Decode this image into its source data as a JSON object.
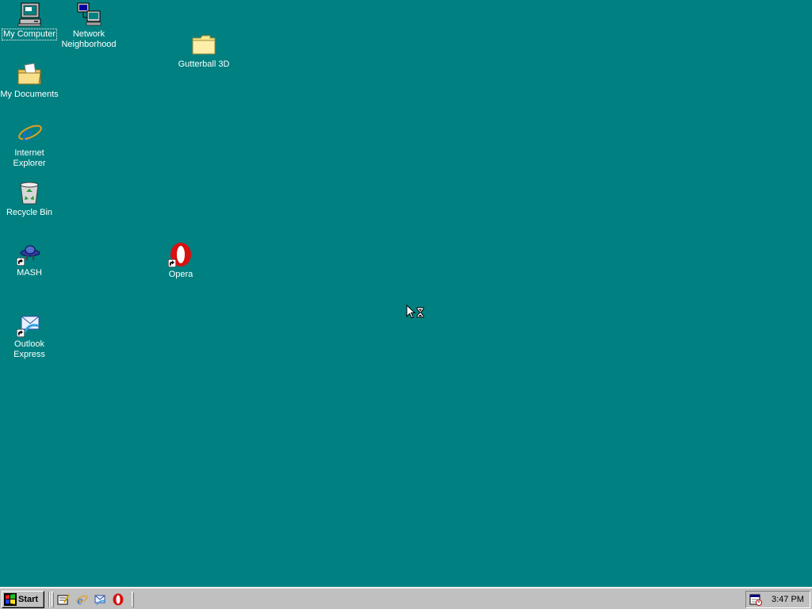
{
  "desktop": {
    "background_color": "#008080",
    "icons": [
      {
        "id": "my-computer",
        "label": "My Computer",
        "icon": "computer-icon",
        "selected": true
      },
      {
        "id": "network-neighborhood",
        "label": "Network\nNeighborhood",
        "icon": "network-icon"
      },
      {
        "id": "gutterball-3d",
        "label": "Gutterball 3D",
        "icon": "folder-icon"
      },
      {
        "id": "my-documents",
        "label": "My Documents",
        "icon": "documents-folder-icon"
      },
      {
        "id": "internet-explorer",
        "label": "Internet\nExplorer",
        "icon": "internet-explorer-icon"
      },
      {
        "id": "recycle-bin",
        "label": "Recycle Bin",
        "icon": "recycle-bin-icon"
      },
      {
        "id": "mash",
        "label": "MASH",
        "icon": "mash-icon",
        "shortcut": true
      },
      {
        "id": "opera",
        "label": "Opera",
        "icon": "opera-icon",
        "shortcut": true
      },
      {
        "id": "outlook-express",
        "label": "Outlook\nExpress",
        "icon": "outlook-express-icon",
        "shortcut": true
      }
    ],
    "cursor": "busy-cursor-icon"
  },
  "taskbar": {
    "start_label": "Start",
    "quick_launch": [
      "show-desktop-icon",
      "internet-explorer-icon",
      "outlook-express-icon",
      "opera-icon"
    ],
    "tray": {
      "icons": [
        "scheduler-icon"
      ],
      "clock": "3:47 PM"
    }
  }
}
